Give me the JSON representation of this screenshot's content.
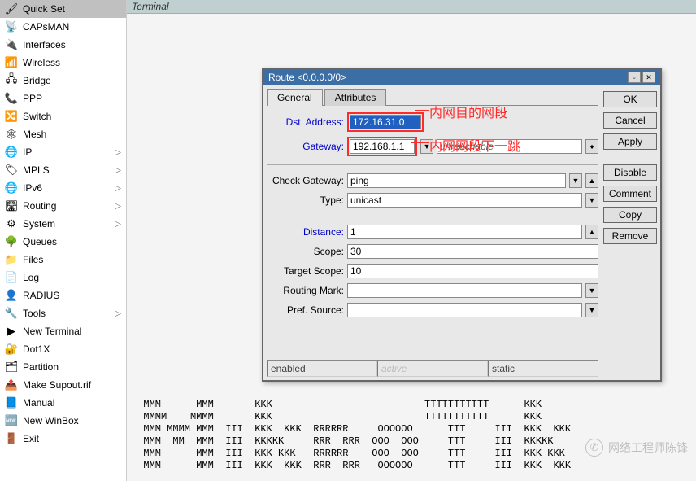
{
  "terminal_tab": "Terminal",
  "sidebar": {
    "items": [
      {
        "icon": "🖌",
        "label": "Quick Set",
        "expandable": false
      },
      {
        "icon": "📡",
        "label": "CAPsMAN",
        "expandable": false
      },
      {
        "icon": "🔌",
        "label": "Interfaces",
        "expandable": false
      },
      {
        "icon": "📶",
        "label": "Wireless",
        "expandable": false
      },
      {
        "icon": "🖧",
        "label": "Bridge",
        "expandable": false
      },
      {
        "icon": "📞",
        "label": "PPP",
        "expandable": false
      },
      {
        "icon": "🔀",
        "label": "Switch",
        "expandable": false
      },
      {
        "icon": "🕸",
        "label": "Mesh",
        "expandable": false
      },
      {
        "icon": "🌐",
        "label": "IP",
        "expandable": true
      },
      {
        "icon": "🏷",
        "label": "MPLS",
        "expandable": true
      },
      {
        "icon": "🌐",
        "label": "IPv6",
        "expandable": true
      },
      {
        "icon": "🛣",
        "label": "Routing",
        "expandable": true
      },
      {
        "icon": "⚙",
        "label": "System",
        "expandable": true
      },
      {
        "icon": "🌳",
        "label": "Queues",
        "expandable": false
      },
      {
        "icon": "📁",
        "label": "Files",
        "expandable": false
      },
      {
        "icon": "📄",
        "label": "Log",
        "expandable": false
      },
      {
        "icon": "👤",
        "label": "RADIUS",
        "expandable": false
      },
      {
        "icon": "🔧",
        "label": "Tools",
        "expandable": true
      },
      {
        "icon": "▶",
        "label": "New Terminal",
        "expandable": false
      },
      {
        "icon": "🔐",
        "label": "Dot1X",
        "expandable": false
      },
      {
        "icon": "🗂",
        "label": "Partition",
        "expandable": false
      },
      {
        "icon": "📤",
        "label": "Make Supout.rif",
        "expandable": false
      },
      {
        "icon": "📘",
        "label": "Manual",
        "expandable": false
      },
      {
        "icon": "🆕",
        "label": "New WinBox",
        "expandable": false
      },
      {
        "icon": "🚪",
        "label": "Exit",
        "expandable": false
      }
    ]
  },
  "route": {
    "title": "Route <0.0.0.0/0>",
    "tabs": [
      "General",
      "Attributes"
    ],
    "active_tab": 0,
    "labels": {
      "dst_address": "Dst. Address:",
      "gateway": "Gateway:",
      "check_gateway": "Check Gateway:",
      "type": "Type:",
      "distance": "Distance:",
      "scope": "Scope:",
      "target_scope": "Target Scope:",
      "routing_mark": "Routing Mark:",
      "pref_source": "Pref. Source:"
    },
    "values": {
      "dst_address": "172.16.31.0",
      "gateway": "192.168.1.1",
      "gateway_status": "unreachable",
      "check_gateway": "ping",
      "type": "unicast",
      "distance": "1",
      "scope": "30",
      "target_scope": "10",
      "routing_mark": "",
      "pref_source": ""
    },
    "status": {
      "enabled": "enabled",
      "active": "active",
      "static": "static"
    },
    "buttons": {
      "ok": "OK",
      "cancel": "Cancel",
      "apply": "Apply",
      "disable": "Disable",
      "comment": "Comment",
      "copy": "Copy",
      "remove": "Remove"
    }
  },
  "annotations": {
    "a1": "内网目的网段",
    "a2": "内网网段下一跳"
  },
  "terminal_text": "  MMM      MMM       KKK                          TTTTTTTTTTT      KKK\n  MMMM    MMMM       KKK                          TTTTTTTTTTT      KKK\n  MMM MMMM MMM  III  KKK  KKK  RRRRRR     OOOOOO      TTT     III  KKK  KKK\n  MMM  MM  MMM  III  KKKKK     RRR  RRR  OOO  OOO     TTT     III  KKKKK\n  MMM      MMM  III  KKK KKK   RRRRRR    OOO  OOO     TTT     III  KKK KKK\n  MMM      MMM  III  KKK  KKK  RRR  RRR   OOOOOO      TTT     III  KKK  KKK",
  "watermark": "网络工程师陈锋"
}
